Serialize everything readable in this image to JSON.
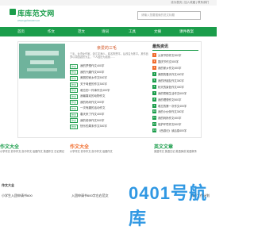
{
  "topbar": {
    "links": "设为首页 | 加入收藏 | 联系我们"
  },
  "logo": {
    "title": "库库范文网",
    "url": "www.gufanwen.cn"
  },
  "search": {
    "placeholder": "请输入您要搜索的范文标题"
  },
  "nav": [
    "首页",
    "作文",
    "范文",
    "诗词",
    "工具",
    "文摘",
    "课件教案"
  ],
  "featured": {
    "title": "亲爱的三毛",
    "desc": "三毛，台湾女作家，浙江定海人，原名陈懋平。后改名为陈平。其作品多以异国游历为主，个人经历为线索……"
  },
  "articles": [
    {
      "tag": "作文",
      "title": "我的梦想作文400字"
    },
    {
      "tag": "作文",
      "title": "我的兴趣作文600字"
    },
    {
      "tag": "作文",
      "title": "美丽的家乡作文500字"
    },
    {
      "tag": "作文",
      "title": "关于母爱的作文300字"
    },
    {
      "tag": "作文",
      "title": "难忘的一件事作文400字"
    },
    {
      "tag": "作文",
      "title": "我最喜欢的动物作文"
    },
    {
      "tag": "作文",
      "title": "我的妈妈作文300字"
    },
    {
      "tag": "作文",
      "title": "一次有趣的活动作文"
    },
    {
      "tag": "作文",
      "title": "春天来了作文400字"
    },
    {
      "tag": "作文",
      "title": "我的老师作文500字"
    },
    {
      "tag": "作文",
      "title": "快乐的周末作文300字"
    }
  ],
  "side": {
    "title": "最热资讯",
    "items": [
      "父亲节的作文300字",
      "国庆节作文500字",
      "我的家乡作文400字",
      "美丽的春天作文400字",
      "我的好朋友作文300字",
      "秋天的景色作文400字",
      "我的寒假生活作文600字",
      "我的理想作文500字",
      "难忘的第一次作文400字",
      "我的小伙伴作文300字",
      "我的妈妈作文400字",
      "保护环境作文500字",
      "《西游记》读后感400字"
    ]
  },
  "categories": [
    {
      "label": "作文大全",
      "color": "#1b9d4b",
      "links": [
        "小学作文",
        "初中作文",
        "高中作文",
        "话题作文",
        "英语作文",
        "日记周记"
      ]
    },
    {
      "label": "作文大全",
      "color": "#f06b2b",
      "links": [
        "小学作文",
        "初中作文",
        "高中作文",
        "话题作文"
      ]
    },
    {
      "label": "英文文章",
      "color": "#1b9d4b",
      "links": [
        "英语作文",
        "英语日记",
        "英语演讲",
        "英语故事"
      ]
    }
  ],
  "bottom": {
    "col1_title": "作文大全",
    "col1_item": "小学生入团申请书600",
    "col2_item": "入团申请书600字左右范文",
    "col3_item": "教师工作计划"
  },
  "watermark": "0401号航库"
}
